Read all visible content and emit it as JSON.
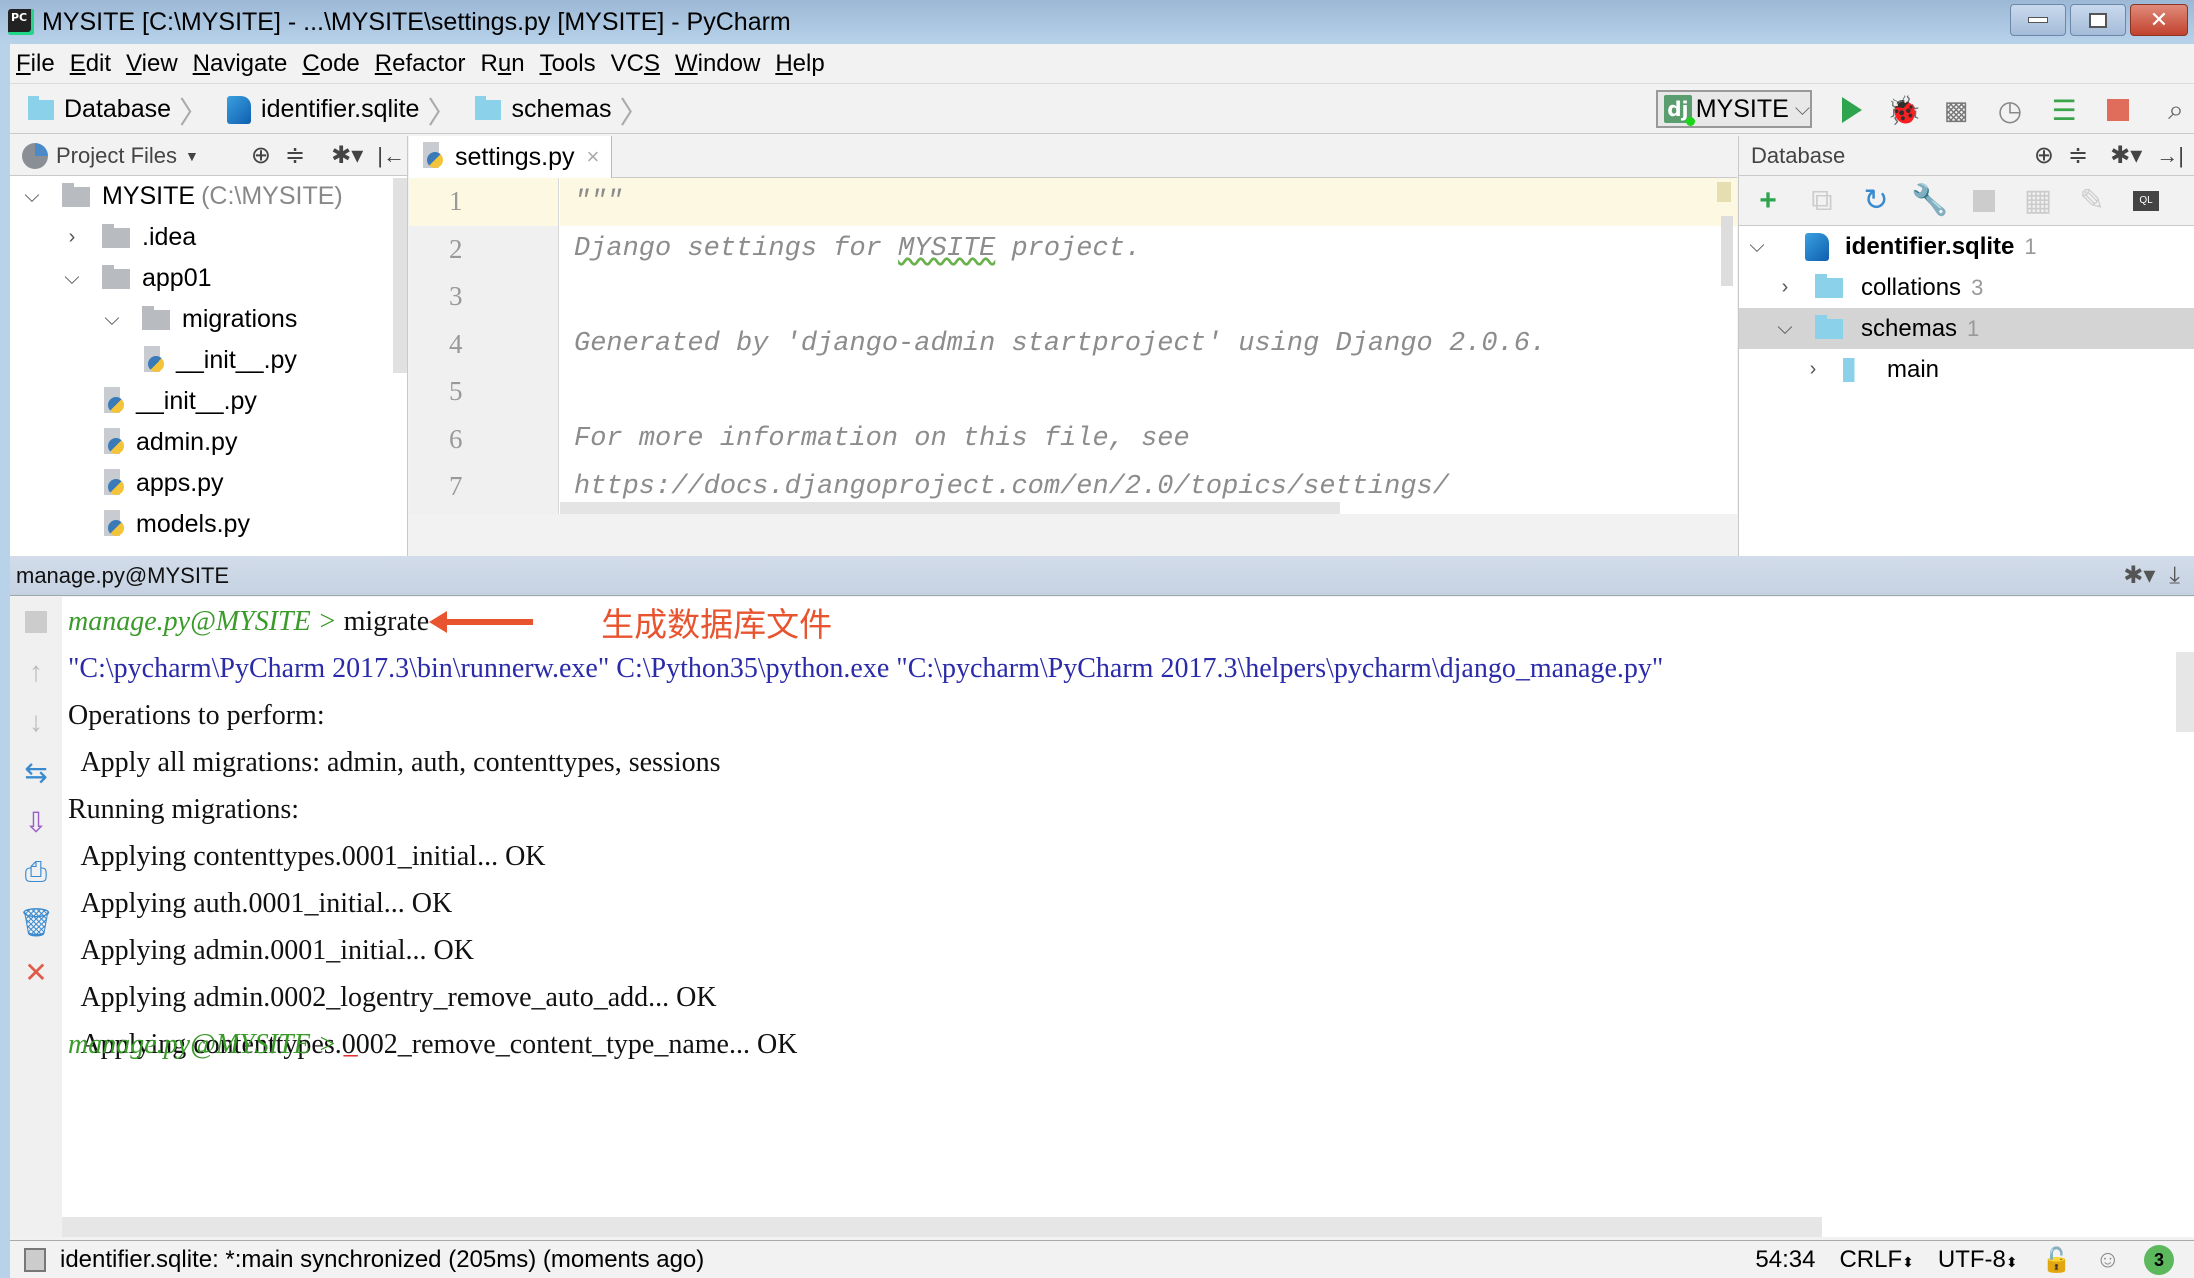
{
  "window": {
    "title": "MYSITE [C:\\MYSITE] - ...\\MYSITE\\settings.py [MYSITE] - PyCharm",
    "app_icon": "PC",
    "controls": {
      "minimize": "minimize-icon",
      "maximize": "maximize-icon",
      "close": "close-icon"
    }
  },
  "menu": [
    {
      "label": "File",
      "mnemonic": "F",
      "rest": "ile"
    },
    {
      "label": "Edit",
      "mnemonic": "E",
      "rest": "dit"
    },
    {
      "label": "View",
      "mnemonic": "V",
      "rest": "iew"
    },
    {
      "label": "Navigate",
      "mnemonic": "N",
      "rest": "avigate"
    },
    {
      "label": "Code",
      "mnemonic": "C",
      "rest": "ode"
    },
    {
      "label": "Refactor",
      "mnemonic": "R",
      "rest": "efactor"
    },
    {
      "label": "Run",
      "pre": "R",
      "mnemonic": "u",
      "rest": "n"
    },
    {
      "label": "Tools",
      "mnemonic": "T",
      "rest": "ools"
    },
    {
      "label": "VCS",
      "pre": "VC",
      "mnemonic": "S",
      "rest": ""
    },
    {
      "label": "Window",
      "mnemonic": "W",
      "rest": "indow"
    },
    {
      "label": "Help",
      "mnemonic": "H",
      "rest": "elp"
    }
  ],
  "breadcrumb": [
    {
      "label": "Database",
      "icon": "folder-icon"
    },
    {
      "label": "identifier.sqlite",
      "icon": "sqlite-icon"
    },
    {
      "label": "schemas",
      "icon": "folder-icon"
    }
  ],
  "toolbar": {
    "run_config": "MYSITE",
    "run_config_icon": "dj",
    "actions": [
      "run",
      "debug",
      "run-with-coverage",
      "profile",
      "concurrency",
      "stop",
      "search"
    ]
  },
  "project_panel": {
    "title": "Project Files",
    "tree": [
      {
        "label": "MYSITE",
        "suffix": "(C:\\MYSITE)",
        "type": "folder",
        "expanded": true,
        "depth": 0
      },
      {
        "label": ".idea",
        "type": "folder",
        "expanded": false,
        "depth": 1
      },
      {
        "label": "app01",
        "type": "folder",
        "expanded": true,
        "depth": 1
      },
      {
        "label": "migrations",
        "type": "folder",
        "expanded": true,
        "depth": 2
      },
      {
        "label": "__init__.py",
        "type": "py",
        "depth": 3
      },
      {
        "label": "__init__.py",
        "type": "py",
        "depth": 2
      },
      {
        "label": "admin.py",
        "type": "py",
        "depth": 2
      },
      {
        "label": "apps.py",
        "type": "py",
        "depth": 2
      },
      {
        "label": "models.py",
        "type": "py",
        "depth": 2
      }
    ]
  },
  "editor": {
    "tab": "settings.py",
    "lines": [
      {
        "no": "1",
        "text": "\"\"\""
      },
      {
        "no": "2",
        "pre": "Django settings for ",
        "squiggle": "MYSITE",
        "post": " project."
      },
      {
        "no": "3",
        "text": ""
      },
      {
        "no": "4",
        "text": "Generated by 'django-admin startproject' using Django 2.0.6."
      },
      {
        "no": "5",
        "text": ""
      },
      {
        "no": "6",
        "text": "For more information on this file, see"
      },
      {
        "no": "7",
        "text": "https://docs.djangoproject.com/en/2.0/topics/settings/"
      }
    ]
  },
  "database_panel": {
    "title": "Database",
    "tree": [
      {
        "label": "identifier.sqlite",
        "count": "1",
        "expanded": true,
        "bold": true
      },
      {
        "label": "collations",
        "count": "3",
        "expanded": false
      },
      {
        "label": "schemas",
        "count": "1",
        "expanded": true,
        "selected": true
      },
      {
        "label": "main",
        "count": "",
        "expanded": false
      }
    ]
  },
  "console": {
    "title": "manage.py@MYSITE",
    "prompt": "manage.py@MYSITE > ",
    "command": "migrate",
    "annotation": "生成数据库文件",
    "command_line": "\"C:\\pycharm\\PyCharm 2017.3\\bin\\runnerw.exe\" C:\\Python35\\python.exe \"C:\\pycharm\\PyCharm 2017.3\\helpers\\pycharm\\django_manage.py\" ",
    "output": [
      "Operations to perform:",
      "  Apply all migrations: admin, auth, contenttypes, sessions",
      "Running migrations:",
      "  Applying contenttypes.0001_initial... OK",
      "  Applying auth.0001_initial... OK",
      "  Applying admin.0001_initial... OK",
      "  Applying admin.0002_logentry_remove_auto_add... OK",
      "  Applying contenttypes.0002_remove_content_type_name... OK"
    ],
    "final_prompt": "manage.py@MYSITE > ",
    "cursor": "_"
  },
  "status": {
    "message": "identifier.sqlite: *:main synchronized (205ms) (moments ago)",
    "position": "54:34",
    "line_sep": "CRLF",
    "encoding": "UTF-8",
    "notifications": "3"
  },
  "colors": {
    "prompt_green": "#3a9a2a",
    "command_blue": "#2b2baa",
    "annotation_red": "#e8542f",
    "selected_row": "#d4d4d4"
  }
}
